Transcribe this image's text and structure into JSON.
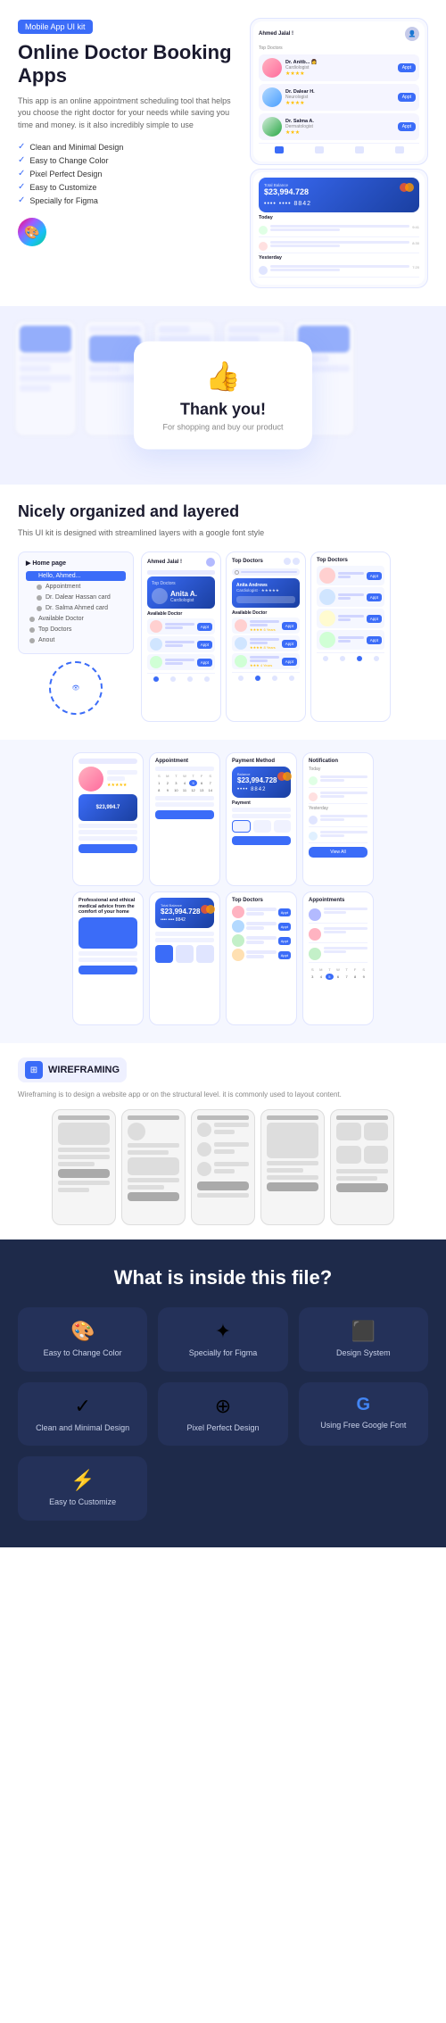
{
  "badge": {
    "label": "Mobile App UI kit"
  },
  "hero": {
    "title": "Online Doctor Booking Apps",
    "description": "This app is an online appointment scheduling tool that helps you choose the right doctor for your needs while saving you time and money. is it also incredibly simple to use",
    "features": [
      "Clean and Minimal Design",
      "Easy to Change Color",
      "Pixel Perfect Design",
      "Easy to Customize",
      "Specially for Figma"
    ]
  },
  "thankyou": {
    "emoji": "👍",
    "title": "Thank you!",
    "subtitle": "For shopping and buy our product"
  },
  "organized": {
    "title": "Nicely organized and layered",
    "description": "This UI kit is designed with streamlined layers with a google font style",
    "layers": [
      {
        "label": "Home page",
        "active": false
      },
      {
        "label": "Hello, Ahmed",
        "active": true
      },
      {
        "label": "Appointment",
        "active": false
      },
      {
        "label": "Dr. Dalear Hassan card",
        "active": false
      },
      {
        "label": "Dr. Salma Ahmed card",
        "active": false
      },
      {
        "label": "Available Doctor",
        "active": false
      },
      {
        "label": "Top Doctors",
        "active": false
      },
      {
        "label": "Anout",
        "active": false
      }
    ]
  },
  "wireframing": {
    "badge_label": "WIREFRAMING",
    "description": "Wireframing is to design a website app or on the structural level. it is commonly used to layout content."
  },
  "inside": {
    "title": "What is inside this file?",
    "items": [
      {
        "emoji": "🎨",
        "label": "Easy to Change Color"
      },
      {
        "emoji": "✦",
        "label": "Specially for Figma"
      },
      {
        "emoji": "⬛",
        "label": "Design System"
      },
      {
        "emoji": "✓",
        "label": "Clean and Minimal Design"
      },
      {
        "emoji": "⊕",
        "label": "Pixel Perfect Design"
      },
      {
        "emoji": "G",
        "label": "Using Free Google Font"
      },
      {
        "emoji": "⚡",
        "label": "Easy to Customize"
      }
    ]
  },
  "bottom_labels": {
    "clean": "Clean and Minimal Design",
    "google_font": "Using Free Google Font"
  }
}
